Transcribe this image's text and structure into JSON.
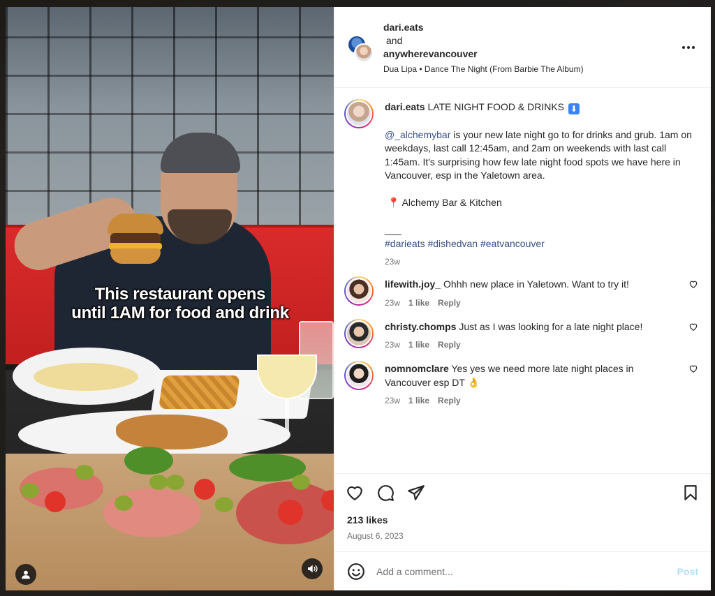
{
  "media": {
    "overlay_line1": "This restaurant opens",
    "overlay_line2": "until 1AM for food and drink"
  },
  "header": {
    "author": "dari.eats",
    "and": "and",
    "collaborator": "anywherevancouver",
    "music": "Dua Lipa • Dance The Night (From Barbie The Album)"
  },
  "caption": {
    "username": "dari.eats",
    "title": "LATE NIGHT FOOD & DRINKS",
    "title_emoji": "⬇",
    "mention": "@_alchemybar",
    "body": " is your new late night go to for drinks and grub. 1am on weekdays, last call 12:45am, and 2am on weekends with last call 1:45am. It's surprising how few late night food spots we have here in Vancouver, esp in the Yaletown area.",
    "location_pin": "📍",
    "location": "Alchemy Bar & Kitchen",
    "separator": "___",
    "hashtags": "#darieats #dishedvan #eatvancouver",
    "age": "23w"
  },
  "comments": [
    {
      "username": "lifewith.joy_",
      "text": "Ohhh new place in Yaletown. Want to try it!",
      "age": "23w",
      "likes": "1 like",
      "reply": "Reply"
    },
    {
      "username": "christy.chomps",
      "text": "Just as I was looking for a late night place!",
      "age": "23w",
      "likes": "1 like",
      "reply": "Reply"
    },
    {
      "username": "nomnomclare",
      "text": "Yes yes we need more late night places in Vancouver esp DT",
      "emoji": "👌",
      "age": "23w",
      "likes": "1 like",
      "reply": "Reply"
    }
  ],
  "actions": {
    "likes": "213 likes",
    "date": "August 6, 2023"
  },
  "add_comment": {
    "placeholder": "Add a comment...",
    "post_label": "Post"
  },
  "icons": {
    "like": "heart-icon",
    "comment": "comment-icon",
    "share": "share-icon",
    "save": "bookmark-icon",
    "emoji": "emoji-icon",
    "more": "more-icon",
    "tag": "user-tag-icon",
    "sound": "sound-icon"
  },
  "colors": {
    "link": "#385185",
    "muted": "#737373",
    "post_disabled": "#b2dffc",
    "text": "#262626"
  }
}
